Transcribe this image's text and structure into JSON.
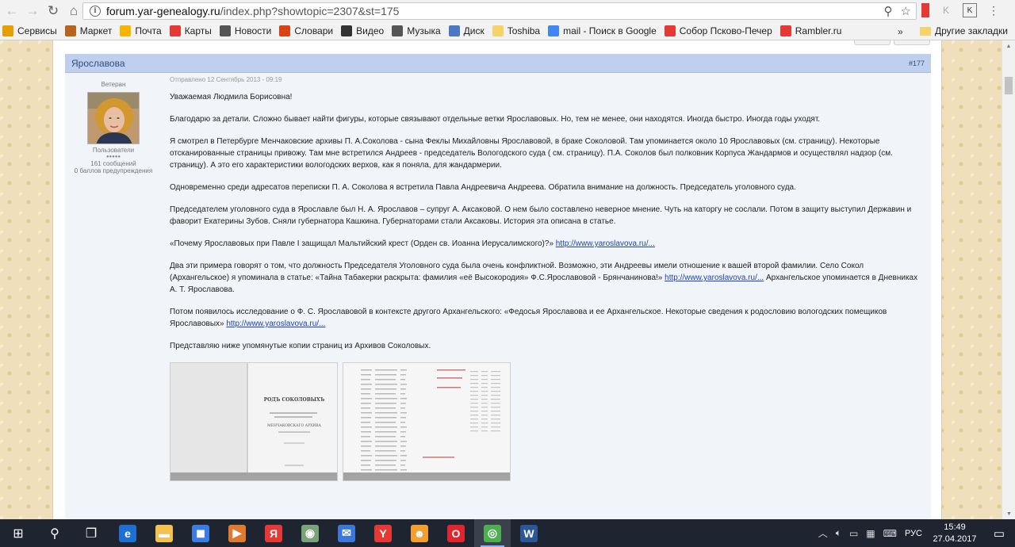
{
  "browser": {
    "url_host": "forum.yar-genealogy.ru",
    "url_path": "/index.php?showtopic=2307&st=175",
    "bookmarks": [
      {
        "label": "Сервисы",
        "icon": "apps-grid-icon",
        "color": "#e5a000"
      },
      {
        "label": "Маркет",
        "icon": "market-icon",
        "color": "#b5651d"
      },
      {
        "label": "Почта",
        "icon": "mail-icon",
        "color": "#f7b500"
      },
      {
        "label": "Карты",
        "icon": "map-pin-icon",
        "color": "#e53935"
      },
      {
        "label": "Новости",
        "icon": "news-icon",
        "color": "#555555"
      },
      {
        "label": "Словари",
        "icon": "dictionary-icon",
        "color": "#d84315"
      },
      {
        "label": "Видео",
        "icon": "video-icon",
        "color": "#333333"
      },
      {
        "label": "Музыка",
        "icon": "music-icon",
        "color": "#555555"
      },
      {
        "label": "Диск",
        "icon": "disk-icon",
        "color": "#4a78c2"
      },
      {
        "label": "Toshiba",
        "icon": "folder-icon",
        "color": "#f6d36a"
      },
      {
        "label": "mail - Поиск в Google",
        "icon": "google-icon",
        "color": "#4285f4"
      },
      {
        "label": "Собор Псково-Печер",
        "icon": "yandex-icon",
        "color": "#e53935"
      },
      {
        "label": "Rambler.ru",
        "icon": "rambler-icon",
        "color": "#e53935"
      }
    ],
    "bookmarks_more": "»",
    "other_bookmarks": "Другие закладки"
  },
  "post": {
    "author": "Ярославова",
    "number": "#177",
    "rank": "Ветеран",
    "group": "Пользователи",
    "stars": "●●●●●",
    "messages": "161 сообщений",
    "warnings": "0 баллов предупреждения",
    "date": "Отправлено 12 Сентябрь 2013 - 09:19",
    "paragraphs": [
      {
        "text": "Уважаемая Людмила Борисовна!"
      },
      {
        "text": "Благодарю за детали. Сложно бывает найти фигуры,  которые связывают отдельные ветки  Ярославовых.  Но, тем  не менее, они находятся. Иногда быстро. Иногда годы уходят."
      },
      {
        "text": "Я  смотрел  в Петербурге Менчаковские архивы П. А.Соколова - сына  Феклы  Михайловны  Ярославовой, в браке Соколовой. Там упоминается около 10 Ярославовых (см. страницу). Некоторые отсканированные страницы привожу. Там мне  встретился  Андреев - председатель Вологодского суда ( см. страницу).  П.А. Соколов  был  полковник  Корпуса  Жандармов и осуществлял надзор (см. страницу). А это его характеристики вологодских верхов,  как   я поняла, для жандармерии."
      },
      {
        "text": "Одновременно  среди  адресатов переписки  П. А. Соколова я встретила Павла Андреевича Андреева. Обратила  внимание на  должность. Председатель уголовного  суда."
      },
      {
        "text": "Председателем  уголовного суда  в Ярославле был Н. А. Ярославов – супруг А. Аксаковой. О нем  было составлено неверное  мнение. Чуть на каторгу не сослали. Потом  в защиту выступил Державин и фаворит Екатерины Зубов.   Сняли губернатора Кашкина. Губернаторами стали Аксаковы. История эта описана в статье."
      },
      {
        "text": "«Почему Ярославовых при Павле I защищал Мальтийский крест (Орден св. Иоанна Иерусалимского)?»  ",
        "link": "http://www.yaroslavova.ru/..."
      },
      {
        "text": "Два  эти примера  говорят о том, что  должность  Председателя   Уголовного суда была очень конфликтной. Возможно, эти Андреевы имели  отношение к вашей второй фамилии. Село Сокол  (Архангельское) я упоминала в  статье:  «Тайна Табакерки раскрыта: фамилия «её Высокородия» Ф.С.Ярославовой - Брянчанинова!»  ",
        "link": "http://www.yaroslavova.ru/...",
        "tail": " Архангельское упоминается в Дневниках А. Т. Ярославова."
      },
      {
        "text": "Потом появилось  исследование о  Ф. С. Ярославовой  в контексте  другого Архангельского: «Федосья Ярославова и ее Архангельское. Некоторые сведения к родословию вологодских помещиков Ярославовых» ",
        "link": "http://www.yaroslavova.ru/..."
      },
      {
        "text": "Представляю ниже  упомянутые копии страниц из Архивов Соколовых."
      }
    ],
    "attachments": [
      {
        "title_lines": [
          "РОДЪ СОКОЛОВЫХЪ",
          "МЕНЧАКОВСКАГО АРХИВА"
        ]
      },
      {
        "title_lines": []
      }
    ]
  },
  "taskbar": {
    "items": [
      {
        "name": "start-button",
        "glyph": "⊞",
        "color": "transparent"
      },
      {
        "name": "search-icon",
        "glyph": "⚲",
        "color": "transparent"
      },
      {
        "name": "task-view-icon",
        "glyph": "❐",
        "color": "transparent"
      },
      {
        "name": "edge-icon",
        "glyph": "e",
        "color": "#1f6fd0"
      },
      {
        "name": "file-explorer-icon",
        "glyph": "▬",
        "color": "#f2c14e"
      },
      {
        "name": "store-icon",
        "glyph": "◼",
        "color": "#3d7de0"
      },
      {
        "name": "media-player-icon",
        "glyph": "▶",
        "color": "#e07a2f"
      },
      {
        "name": "yandex-browser-icon",
        "glyph": "Я",
        "color": "#e53935"
      },
      {
        "name": "app-circle-icon",
        "glyph": "◉",
        "color": "#7aa37a"
      },
      {
        "name": "mail-app-icon",
        "glyph": "✉",
        "color": "#3b79d8"
      },
      {
        "name": "yandex-icon",
        "glyph": "Y",
        "color": "#e53935"
      },
      {
        "name": "chat-app-icon",
        "glyph": "☻",
        "color": "#f0a030"
      },
      {
        "name": "opera-icon",
        "glyph": "O",
        "color": "#e0262c"
      },
      {
        "name": "chrome-icon",
        "glyph": "◎",
        "color": "#4caf50"
      },
      {
        "name": "word-icon",
        "glyph": "W",
        "color": "#2b5797"
      }
    ],
    "language": "РУС",
    "time": "15:49",
    "date": "27.04.2017"
  }
}
